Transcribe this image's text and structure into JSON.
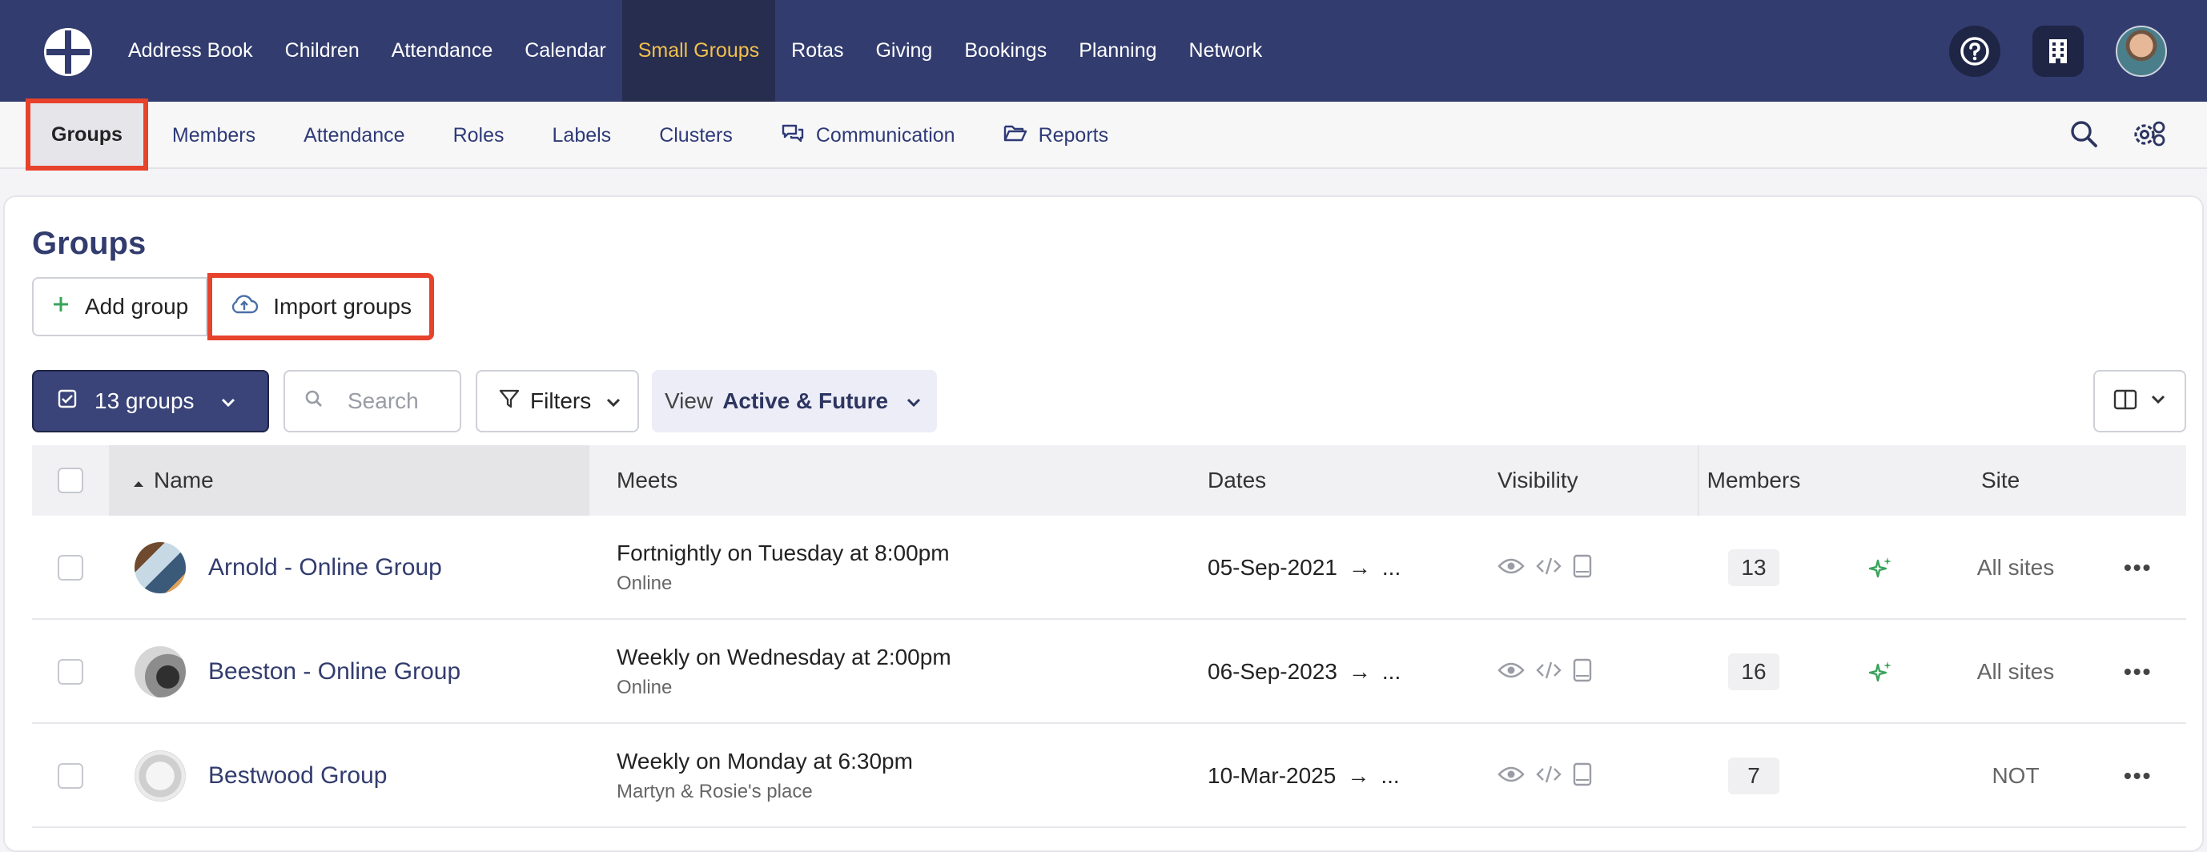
{
  "topnav": {
    "items": [
      "Address Book",
      "Children",
      "Attendance",
      "Calendar",
      "Small Groups",
      "Rotas",
      "Giving",
      "Bookings",
      "Planning",
      "Network"
    ],
    "active": "Small Groups",
    "help_icon": "help-circle-icon",
    "org_icon": "building-icon",
    "avatar_icon": "user-avatar"
  },
  "subnav": {
    "items": [
      {
        "label": "Groups",
        "icon": ""
      },
      {
        "label": "Members",
        "icon": ""
      },
      {
        "label": "Attendance",
        "icon": ""
      },
      {
        "label": "Roles",
        "icon": ""
      },
      {
        "label": "Labels",
        "icon": ""
      },
      {
        "label": "Clusters",
        "icon": ""
      },
      {
        "label": "Communication",
        "icon": "chat-bubbles-icon"
      },
      {
        "label": "Reports",
        "icon": "folder-open-icon"
      }
    ],
    "active": "Groups"
  },
  "page": {
    "title": "Groups",
    "add_label": "Add group",
    "import_label": "Import groups"
  },
  "toolbar": {
    "select_label": "13 groups",
    "search_placeholder": "Search",
    "filters_label": "Filters",
    "view_prefix": "View",
    "view_value": "Active & Future"
  },
  "table": {
    "headers": {
      "name": "Name",
      "meets": "Meets",
      "dates": "Dates",
      "visibility": "Visibility",
      "members": "Members",
      "site": "Site"
    },
    "rows": [
      {
        "name": "Arnold - Online Group",
        "meets": "Fortnightly on Tuesday at 8:00pm",
        "meets_sub": "Online",
        "start": "05-Sep-2021",
        "end": "...",
        "members": "13",
        "sparkle": true,
        "site": "All sites"
      },
      {
        "name": "Beeston - Online Group",
        "meets": "Weekly on Wednesday at 2:00pm",
        "meets_sub": "Online",
        "start": "06-Sep-2023",
        "end": "...",
        "members": "16",
        "sparkle": true,
        "site": "All sites"
      },
      {
        "name": "Bestwood Group",
        "meets": "Weekly on Monday at 6:30pm",
        "meets_sub": "Martyn & Rosie's place",
        "start": "10-Mar-2025",
        "end": "...",
        "members": "7",
        "sparkle": false,
        "site": "NOT"
      }
    ]
  },
  "colors": {
    "nav_bg": "#323c6e",
    "active_nav": "#f2c04b",
    "highlight": "#e6422c",
    "sparkle": "#3aa35b"
  }
}
